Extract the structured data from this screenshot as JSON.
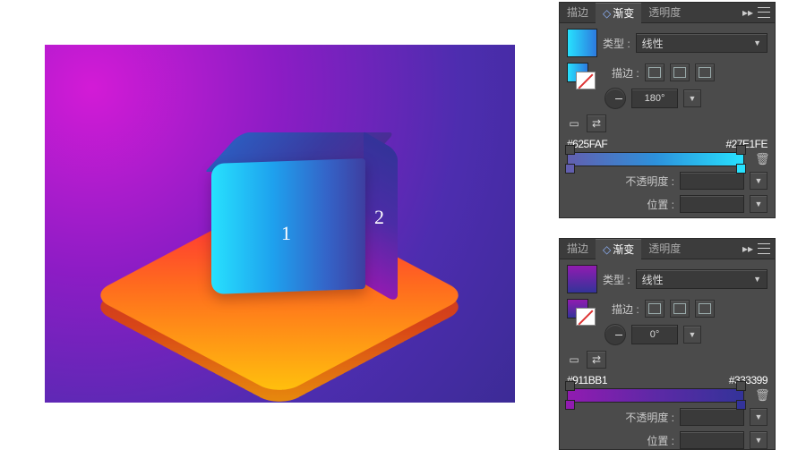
{
  "artwork": {
    "labels": [
      "1",
      "2"
    ]
  },
  "panels": [
    {
      "tabs": {
        "stroke": "描边",
        "gradient": "渐变",
        "transparency": "透明度"
      },
      "type_label": "类型 :",
      "type_value": "线性",
      "stroke_label": "描边 :",
      "angle": "180°",
      "hex_left": "#625FAF",
      "hex_right": "#27E1FE",
      "opacity_label": "不透明度 :",
      "position_label": "位置 :"
    },
    {
      "tabs": {
        "stroke": "描边",
        "gradient": "渐变",
        "transparency": "透明度"
      },
      "type_label": "类型 :",
      "type_value": "线性",
      "stroke_label": "描边 :",
      "angle": "0°",
      "hex_left": "#911BB1",
      "hex_right": "#333399",
      "opacity_label": "不透明度 :",
      "position_label": "位置 :"
    }
  ]
}
